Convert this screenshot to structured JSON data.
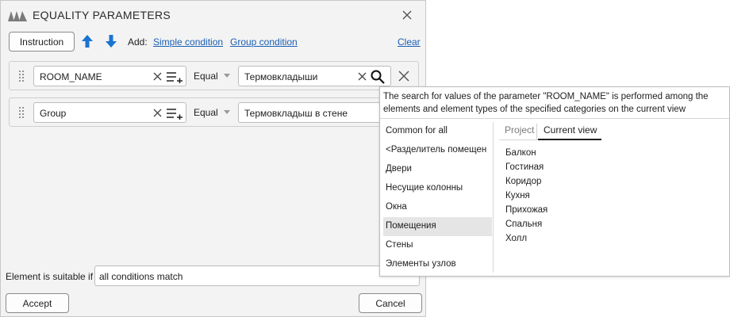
{
  "dialog": {
    "title": "EQUALITY PARAMETERS",
    "instruction_label": "Instruction",
    "add_label": "Add:",
    "simple_condition_label": "Simple condition",
    "group_condition_label": "Group condition",
    "clear_label": "Clear",
    "conditions": [
      {
        "parameter": "ROOM_NAME",
        "operator": "Equal",
        "value": "Термовкладыши"
      },
      {
        "parameter": "Group",
        "operator": "Equal",
        "value": "Термовкладыш в стене"
      }
    ],
    "suitable_label": "Element is suitable if",
    "suitable_value": "all conditions match",
    "accept_label": "Accept",
    "cancel_label": "Cancel"
  },
  "popup": {
    "description": "The search for values of the parameter \"ROOM_NAME\" is performed among the elements and element types of the specified categories on the current view",
    "categories": [
      "Common for all",
      "<Разделитель помещен",
      "Двери",
      "Несущие колонны",
      "Окна",
      "Помещения",
      "Стены",
      "Элементы узлов"
    ],
    "selected_category": "Помещения",
    "tabs": [
      "Project",
      "Current view"
    ],
    "active_tab": "Current view",
    "values": [
      "Балкон",
      "Гостиная",
      "Коридор",
      "Кухня",
      "Прихожая",
      "Спальня",
      "Холл"
    ]
  },
  "colors": {
    "accent_blue": "#1a73d0",
    "link": "#1a5fb4",
    "selection": "#e5e5e5"
  }
}
